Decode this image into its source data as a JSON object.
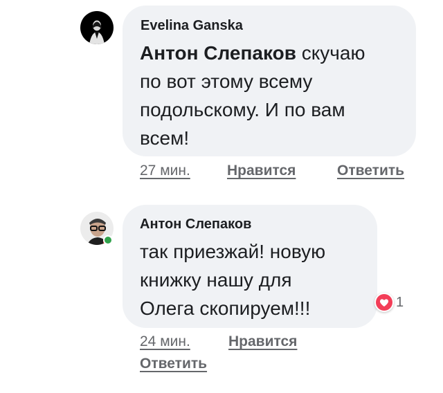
{
  "comments": [
    {
      "author": "Evelina Ganska",
      "mention": "Антон Слепаков",
      "text_lines": [
        "скучаю",
        "по вот этому всему",
        "подольскому. И по вам",
        "всем!"
      ],
      "time": "27 мин.",
      "like_label": "Нравится",
      "reply_label": "Ответить"
    },
    {
      "author": "Антон Слепаков",
      "text_lines": [
        "так приезжай! новую",
        "книжку нашу для",
        "Олега скопируем!!!"
      ],
      "time": "24 мин.",
      "like_label": "Нравится",
      "reply_label": "Ответить",
      "reaction_count": "1",
      "reaction_icon": "heart-icon",
      "online": true
    }
  ],
  "colors": {
    "bubble_bg": "#f0f2f5",
    "meta_text": "#65676b",
    "heart": "#f33e58",
    "online": "#31a24c"
  }
}
